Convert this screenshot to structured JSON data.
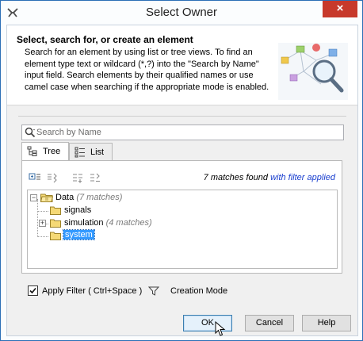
{
  "window": {
    "title": "Select Owner",
    "close_glyph": "×"
  },
  "header": {
    "title": "Select, search for, or create an element",
    "description": "Search for an element by using list or tree views. To find an element type text or wildcard (*,?) into the \"Search by Name\" input field. Search elements by their qualified names or use camel case when searching if the appropriate mode is enabled."
  },
  "search": {
    "placeholder": "Search by Name",
    "value": ""
  },
  "tabs": [
    {
      "label": "Tree",
      "icon": "tree-icon",
      "active": true
    },
    {
      "label": "List",
      "icon": "list-icon",
      "active": false
    }
  ],
  "toolbar": {
    "tools": [
      "expand-all-icon",
      "collapse-all-icon",
      "expand-selected-icon",
      "collapse-selected-icon"
    ],
    "matches_text": "7 matches found ",
    "filter_link": "with filter applied"
  },
  "tree": {
    "root": {
      "label": "Data",
      "count": "(7 matches)",
      "expanded": true
    },
    "children": [
      {
        "label": "signals",
        "count": "",
        "expandable": false
      },
      {
        "label": "simulation",
        "count": "(4 matches)",
        "expandable": true
      },
      {
        "label": "system",
        "count": "",
        "expandable": false,
        "selected": true
      }
    ]
  },
  "filter": {
    "checked": true,
    "label": "Apply Filter ( Ctrl+Space )",
    "mode_label": "Creation Mode"
  },
  "buttons": {
    "ok": "OK",
    "cancel": "Cancel",
    "help": "Help"
  },
  "colors": {
    "close_red": "#c7392b",
    "selection_blue": "#3399ff",
    "link_blue": "#1a3fcf",
    "folder_yellow": "#f5d976"
  }
}
